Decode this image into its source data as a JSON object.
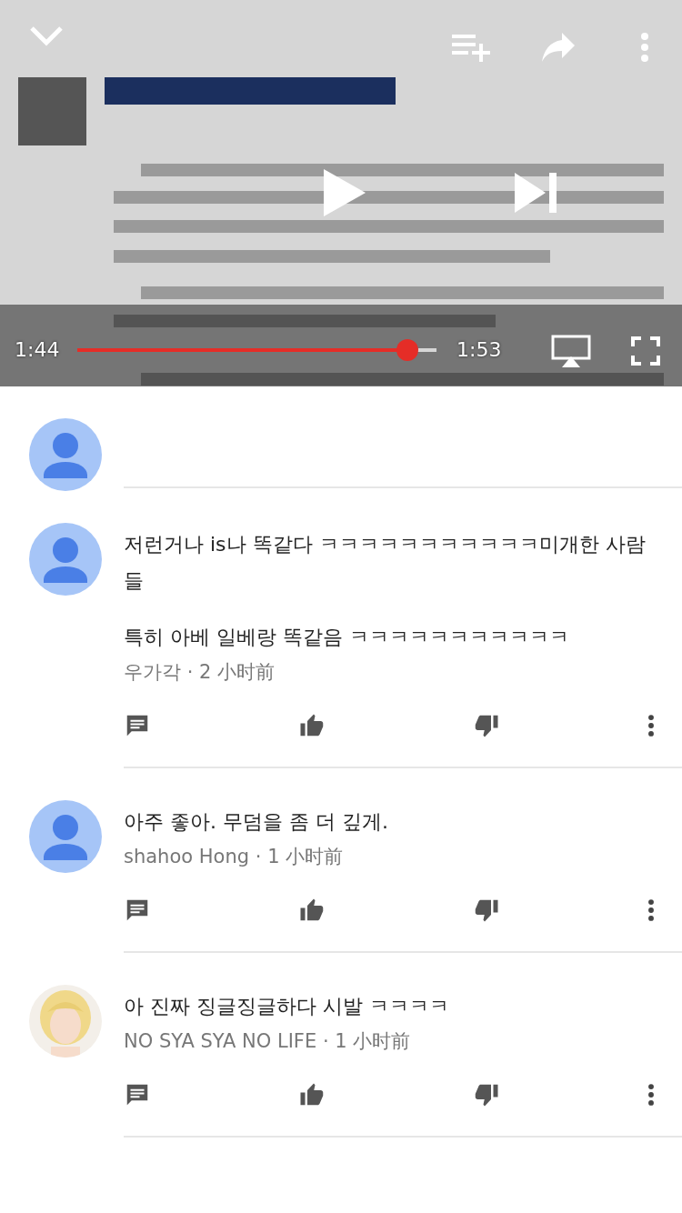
{
  "player": {
    "elapsed": "1:44",
    "duration": "1:53",
    "level": 0.92
  },
  "comments": [
    {
      "kind": "default",
      "paragraphs": [
        "저런거나 is나 똑같다 ㅋㅋㅋㅋㅋㅋㅋㅋㅋㅋㅋ미개한 사람들",
        "특히 아베 일베랑 똑같음 ㅋㅋㅋㅋㅋㅋㅋㅋㅋㅋㅋ"
      ],
      "author": "우가각",
      "separator": "·",
      "time": "2 小时前"
    },
    {
      "kind": "default",
      "paragraphs": [
        "아주 좋아. 무덤을 좀 더 깊게."
      ],
      "author": "shahoo Hong",
      "separator": "·",
      "time": "1 小时前"
    },
    {
      "paragraphs": [
        "아 진짜 징글징글하다 시발 ㅋㅋㅋㅋ"
      ],
      "author": "NO SYA SYA NO LIFE",
      "separator": "·",
      "time": "1 小时前"
    }
  ]
}
